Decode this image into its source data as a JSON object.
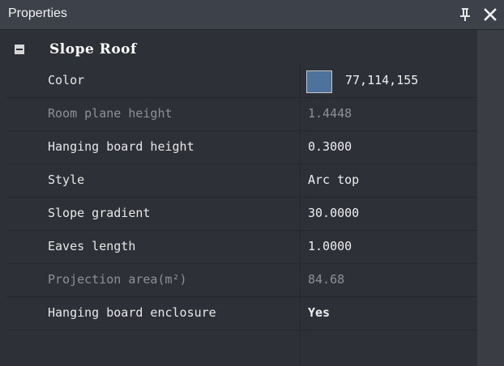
{
  "panel": {
    "title": "Properties",
    "pin_icon": "pin-icon",
    "close_icon": "close-icon"
  },
  "category": {
    "label": "Slope Roof",
    "toggle_icon": "collapse-minus-icon"
  },
  "rows": [
    {
      "name": "Color",
      "value": "77,114,155",
      "swatch_color": "#4d729b",
      "readonly": false
    },
    {
      "name": "Room plane height",
      "value": "1.4448",
      "readonly": true
    },
    {
      "name": "Hanging board height",
      "value": "0.3000",
      "readonly": false
    },
    {
      "name": "Style",
      "value": "Arc top",
      "readonly": false
    },
    {
      "name": "Slope gradient",
      "value": "30.0000",
      "readonly": false
    },
    {
      "name": "Eaves length",
      "value": "1.0000",
      "readonly": false
    },
    {
      "name": "Projection area(m²)",
      "value": "84.68",
      "readonly": true
    },
    {
      "name": "Hanging board enclosure",
      "value": "Yes",
      "readonly": false
    }
  ],
  "colors": {
    "background": "#2d3037",
    "titlebar": "#3d4149",
    "readonly_text": "#8e9196",
    "text": "#e8e8e8"
  }
}
